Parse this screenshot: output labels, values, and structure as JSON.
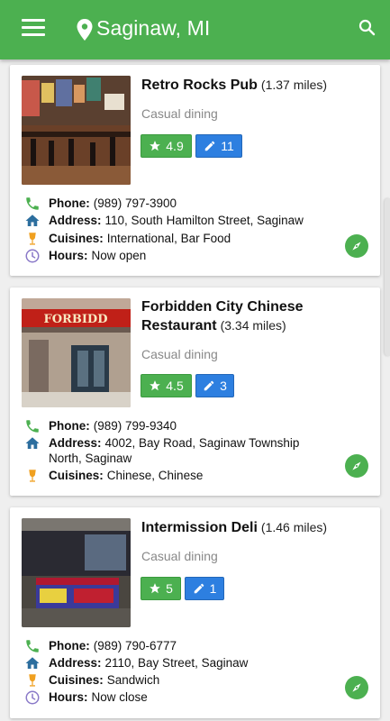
{
  "header": {
    "title": "Saginaw, MI",
    "icons": {
      "menu": "menu-icon",
      "location": "location-pin-icon",
      "search": "search-icon"
    }
  },
  "colors": {
    "appbar": "#4cb050",
    "rating": "#4cb050",
    "reviews": "#2d7fe0",
    "phone": "#4cb050",
    "address": "#2c6e9e",
    "cuisine": "#f0a020",
    "hours": "#8a79c8"
  },
  "restaurants": [
    {
      "name": "Retro Rocks Pub",
      "distance": "(1.37 miles)",
      "category": "Casual dining",
      "rating": "4.9",
      "reviews": "11",
      "phone_label": "Phone:",
      "phone": "(989) 797-3900",
      "address_label": "Address:",
      "address": "110, South Hamilton Street, Saginaw",
      "cuisines_label": "Cuisines:",
      "cuisines": "International, Bar Food",
      "hours_label": "Hours:",
      "hours": "Now open"
    },
    {
      "name": "Forbidden City Chinese",
      "name_line2": "Restaurant",
      "distance": "(3.34 miles)",
      "category": "Casual dining",
      "rating": "4.5",
      "reviews": "3",
      "phone_label": "Phone:",
      "phone": "(989) 799-9340",
      "address_label": "Address:",
      "address": "4002, Bay Road, Saginaw Township",
      "address_line2": "North, Saginaw",
      "cuisines_label": "Cuisines:",
      "cuisines": "Chinese, Chinese",
      "sign_text": "FORBIDD"
    },
    {
      "name": "Intermission Deli",
      "distance": "(1.46 miles)",
      "category": "Casual dining",
      "rating": "5",
      "reviews": "1",
      "phone_label": "Phone:",
      "phone": "(989) 790-6777",
      "address_label": "Address:",
      "address": "2110, Bay Street, Saginaw",
      "cuisines_label": "Cuisines:",
      "cuisines": "Sandwich",
      "hours_label": "Hours:",
      "hours": "Now close"
    }
  ]
}
